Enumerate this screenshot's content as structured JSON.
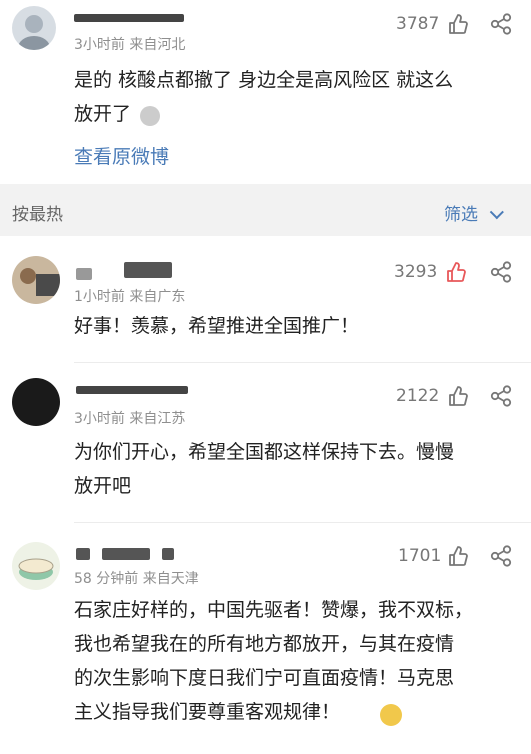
{
  "colors": {
    "separator": "#f2f2f2",
    "link": "#4a7bb7",
    "liked": "#e8585a",
    "meta": "#8f8f8f"
  },
  "top_post": {
    "meta": "3小时前  来自河北",
    "count": "3787",
    "text_line1": "是的 核酸点都撤了 身边全是高风险区 就这么",
    "text_line2": "放开了",
    "link": "查看原微博"
  },
  "sort": {
    "label": "按最热",
    "filter": "筛选"
  },
  "comments": [
    {
      "meta": "1小时前  来自广东",
      "count": "3293",
      "liked": true,
      "lines": [
        "好事！羡慕，希望推进全国推广！"
      ]
    },
    {
      "meta": "3小时前  来自江苏",
      "count": "2122",
      "liked": false,
      "lines": [
        "为你们开心，希望全国都这样保持下去。慢慢",
        "放开吧"
      ]
    },
    {
      "meta": "58 分钟前  来自天津",
      "count": "1701",
      "liked": false,
      "lines": [
        "石家庄好样的，中国先驱者！赞爆，我不双标，",
        "我也希望我在的所有地方都放开，与其在疫情",
        "的次生影响下度日我们宁可直面疫情！马克思",
        "主义指导我们要尊重客观规律！"
      ]
    }
  ],
  "icons": {
    "like": "thumbs-up-icon",
    "share": "share-icon",
    "filter": "chevron-down-icon"
  }
}
